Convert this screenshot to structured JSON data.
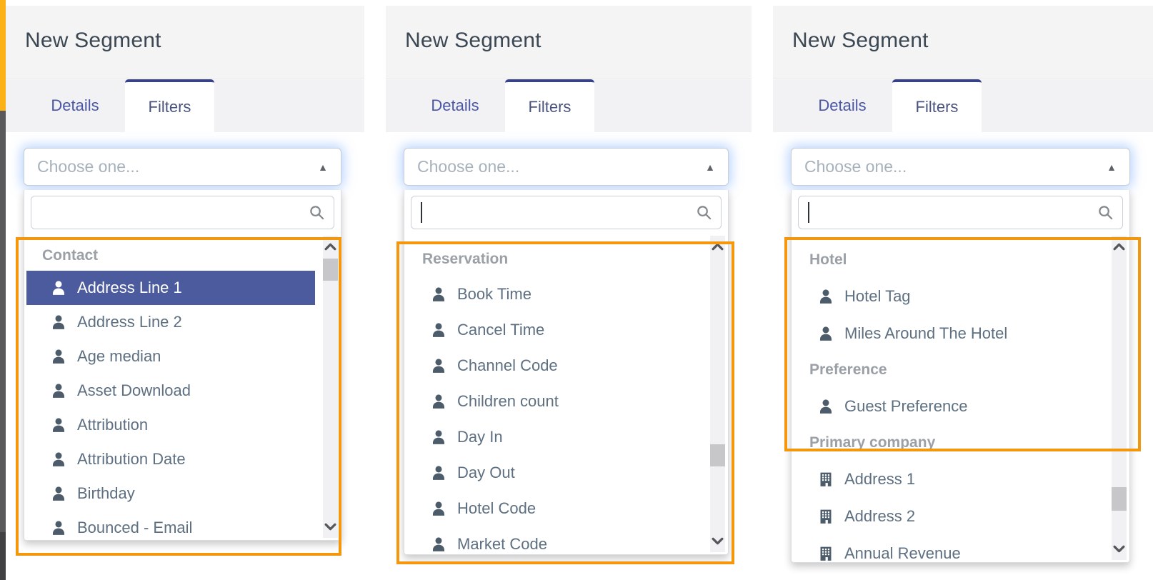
{
  "colors": {
    "accent_orange": "#F2970E",
    "rail_yellow": "#FCB216",
    "rail_gray": "#59595B",
    "rail_dark": "#414144",
    "selected_bg": "#4C5B9E",
    "tab_accent": "#35418F"
  },
  "panels": [
    {
      "title": "New Segment",
      "tabs": [
        {
          "label": "Details",
          "active": false
        },
        {
          "label": "Filters",
          "active": true
        }
      ],
      "select_placeholder": "Choose one...",
      "search_value": "",
      "search_caret": false,
      "groups": [
        {
          "name": "Contact",
          "items": [
            {
              "label": "Address Line 1",
              "icon": "person",
              "selected": true
            },
            {
              "label": "Address Line 2",
              "icon": "person"
            },
            {
              "label": "Age median",
              "icon": "person"
            },
            {
              "label": "Asset Download",
              "icon": "person"
            },
            {
              "label": "Attribution",
              "icon": "person"
            },
            {
              "label": "Attribution Date",
              "icon": "person"
            },
            {
              "label": "Birthday",
              "icon": "person"
            },
            {
              "label": "Bounced - Email",
              "icon": "person"
            }
          ]
        }
      ]
    },
    {
      "title": "New Segment",
      "tabs": [
        {
          "label": "Details",
          "active": false
        },
        {
          "label": "Filters",
          "active": true
        }
      ],
      "select_placeholder": "Choose one...",
      "search_value": "",
      "search_caret": true,
      "groups": [
        {
          "name": "Reservation",
          "items": [
            {
              "label": "Book Time",
              "icon": "person"
            },
            {
              "label": "Cancel Time",
              "icon": "person"
            },
            {
              "label": "Channel Code",
              "icon": "person"
            },
            {
              "label": "Children count",
              "icon": "person"
            },
            {
              "label": "Day In",
              "icon": "person"
            },
            {
              "label": "Day Out",
              "icon": "person"
            },
            {
              "label": "Hotel Code",
              "icon": "person"
            },
            {
              "label": "Market Code",
              "icon": "person"
            }
          ]
        }
      ]
    },
    {
      "title": "New Segment",
      "tabs": [
        {
          "label": "Details",
          "active": false
        },
        {
          "label": "Filters",
          "active": true
        }
      ],
      "select_placeholder": "Choose one...",
      "search_value": "",
      "search_caret": true,
      "groups": [
        {
          "name": "Hotel",
          "items": [
            {
              "label": "Hotel Tag",
              "icon": "person"
            },
            {
              "label": "Miles Around The Hotel",
              "icon": "person"
            }
          ]
        },
        {
          "name": "Preference",
          "items": [
            {
              "label": "Guest Preference",
              "icon": "person"
            }
          ]
        },
        {
          "name": "Primary company",
          "items": [
            {
              "label": "Address 1",
              "icon": "building"
            },
            {
              "label": "Address 2",
              "icon": "building"
            },
            {
              "label": "Annual Revenue",
              "icon": "building"
            }
          ]
        }
      ]
    }
  ]
}
